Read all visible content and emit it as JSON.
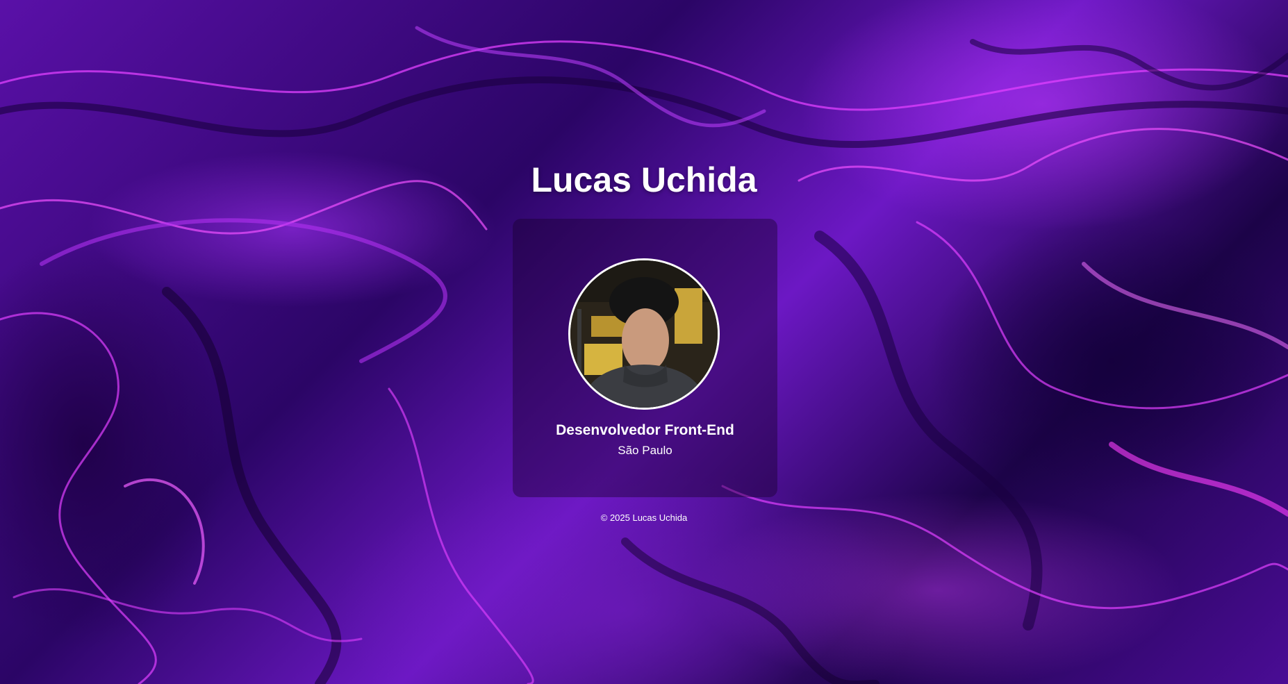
{
  "header": {
    "title": "Lucas Uchida"
  },
  "profile": {
    "role": "Desenvolvedor Front-End",
    "location": "São Paulo"
  },
  "footer": {
    "copyright": "© 2025 Lucas Uchida"
  },
  "colors": {
    "background_primary": "#4a0c95",
    "background_accent": "#d020ff",
    "text": "#ffffff",
    "card_overlay": "rgba(25, 0, 45, 0.42)"
  }
}
